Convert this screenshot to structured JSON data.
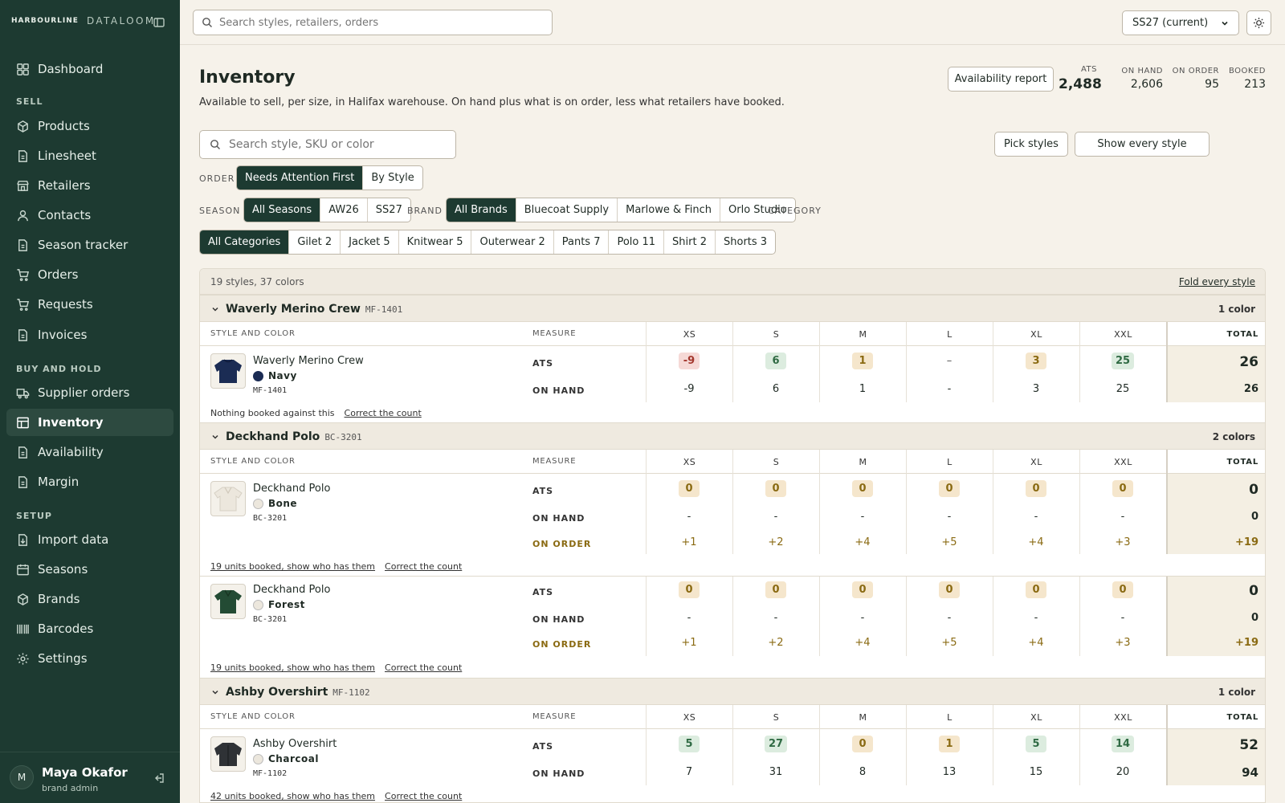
{
  "app": {
    "brand_top": "HARBOURLINE",
    "brand_name": "DATALOOM"
  },
  "sidebar": {
    "items": [
      {
        "label": "Dashboard",
        "icon": "dashboard-icon"
      },
      {
        "label": "Products",
        "icon": "box-icon"
      },
      {
        "label": "Linesheet",
        "icon": "document-icon"
      },
      {
        "label": "Retailers",
        "icon": "store-icon"
      },
      {
        "label": "Contacts",
        "icon": "person-icon"
      },
      {
        "label": "Season tracker",
        "icon": "document-icon"
      },
      {
        "label": "Orders",
        "icon": "cart-icon"
      },
      {
        "label": "Requests",
        "icon": "cart-icon"
      },
      {
        "label": "Invoices",
        "icon": "document-icon"
      },
      {
        "label": "Supplier orders",
        "icon": "truck-icon"
      },
      {
        "label": "Inventory",
        "icon": "table-icon"
      },
      {
        "label": "Availability",
        "icon": "document-icon"
      },
      {
        "label": "Margin",
        "icon": "document-icon"
      },
      {
        "label": "Import data",
        "icon": "import-icon"
      },
      {
        "label": "Seasons",
        "icon": "calendar-icon"
      },
      {
        "label": "Brands",
        "icon": "box-icon"
      },
      {
        "label": "Barcodes",
        "icon": "barcode-icon"
      },
      {
        "label": "Settings",
        "icon": "gear-icon"
      }
    ],
    "sections": {
      "sell": "SELL",
      "buy": "BUY AND HOLD",
      "setup": "SETUP"
    },
    "active": "Inventory",
    "user": {
      "initial": "M",
      "name": "Maya Okafor",
      "role": "brand admin"
    }
  },
  "topbar": {
    "search_placeholder": "Search styles, retailers, orders",
    "season": "SS27 (current)"
  },
  "page": {
    "title": "Inventory",
    "subtitle": "Available to sell, per size, in Halifax warehouse. On hand plus what is on order, less what retailers have booked.",
    "availability_button": "Availability report",
    "stats": [
      {
        "label": "ATS",
        "value": "2,488"
      },
      {
        "label": "ON HAND",
        "value": "2,606"
      },
      {
        "label": "ON ORDER",
        "value": "95"
      },
      {
        "label": "BOOKED",
        "value": "213"
      }
    ],
    "search_placeholder": "Search style, SKU or color",
    "pick_styles": "Pick styles",
    "show_every": "Show every style"
  },
  "filters": {
    "order_label": "ORDER",
    "order_options": [
      "Needs Attention First",
      "By Style"
    ],
    "season_label": "SEASON",
    "season_options": [
      "All Seasons",
      "AW26",
      "SS27"
    ],
    "brand_label": "BRAND",
    "brand_options": [
      "All Brands",
      "Bluecoat Supply",
      "Marlowe & Finch",
      "Orlo Studio"
    ],
    "category_label": "CATEGORY",
    "category_options": [
      "All Categories",
      "Gilet 2",
      "Jacket 5",
      "Knitwear 5",
      "Outerwear 2",
      "Pants 7",
      "Polo 11",
      "Shirt 2",
      "Shorts 3"
    ]
  },
  "table": {
    "summary": "19 styles, 37 colors",
    "fold_all": "Fold every style",
    "col_style": "STYLE AND COLOR",
    "col_measure": "MEASURE",
    "sizes": [
      "XS",
      "S",
      "M",
      "L",
      "XL",
      "XXL"
    ],
    "col_total": "TOTAL",
    "groups": [
      {
        "name": "Waverly Merino Crew",
        "sku": "MF-1401",
        "count": "1 color",
        "rows": [
          {
            "name": "Waverly Merino Crew",
            "color": "Navy",
            "sku": "MF-1401",
            "ats": [
              "-9",
              "6",
              "1",
              "–",
              "3",
              "25"
            ],
            "ats_total": "26",
            "onhand": [
              "-9",
              "6",
              "1",
              "-",
              "3",
              "25"
            ],
            "onhand_total": "26",
            "foot": "Nothing booked against this",
            "correct": "Correct the count"
          }
        ]
      },
      {
        "name": "Deckhand Polo",
        "sku": "BC-3201",
        "count": "2 colors",
        "rows": [
          {
            "name": "Deckhand Polo",
            "color": "Bone",
            "sku": "BC-3201",
            "ats": [
              "0",
              "0",
              "0",
              "0",
              "0",
              "0"
            ],
            "ats_total": "0",
            "onhand": [
              "-",
              "-",
              "-",
              "-",
              "-",
              "-"
            ],
            "onhand_total": "0",
            "onorder": [
              "+1",
              "+2",
              "+4",
              "+5",
              "+4",
              "+3"
            ],
            "onorder_total": "+19",
            "foot": "19 units booked, show who has them",
            "correct": "Correct the count"
          },
          {
            "name": "Deckhand Polo",
            "color": "Forest",
            "sku": "BC-3201",
            "ats": [
              "0",
              "0",
              "0",
              "0",
              "0",
              "0"
            ],
            "ats_total": "0",
            "onhand": [
              "-",
              "-",
              "-",
              "-",
              "-",
              "-"
            ],
            "onhand_total": "0",
            "onorder": [
              "+1",
              "+2",
              "+4",
              "+5",
              "+4",
              "+3"
            ],
            "onorder_total": "+19",
            "foot": "19 units booked, show who has them",
            "correct": "Correct the count"
          }
        ]
      },
      {
        "name": "Ashby Overshirt",
        "sku": "MF-1102",
        "count": "1 color",
        "rows": [
          {
            "name": "Ashby Overshirt",
            "color": "Charcoal",
            "sku": "MF-1102",
            "ats": [
              "5",
              "27",
              "0",
              "1",
              "5",
              "14"
            ],
            "ats_total": "52",
            "onhand": [
              "7",
              "31",
              "8",
              "13",
              "15",
              "20"
            ],
            "onhand_total": "94",
            "foot": "42 units booked, show who has them",
            "correct": "Correct the count"
          }
        ]
      }
    ],
    "measures": {
      "ats": "ATS",
      "onhand": "ON HAND",
      "onorder": "ON ORDER"
    }
  },
  "colors": {
    "sidebar": "#1d3a31",
    "accent": "#1d3a31",
    "negative": "#a3372d",
    "positive": "#2f6a43",
    "warning": "#8a6a12"
  }
}
